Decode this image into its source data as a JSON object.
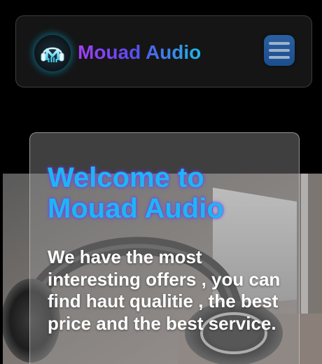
{
  "navbar": {
    "brand": "Mouad Audio",
    "logo_icon": "headphones-m-logo-icon",
    "menu_icon": "hamburger-menu-icon"
  },
  "hero": {
    "title": "Welcome to Mouad Audio",
    "text": "We have the most interesting offers , you can find haut qualitie , the best price and the best service.",
    "image_icon": "headphones-photo"
  },
  "colors": {
    "page_background": "#000000",
    "navbar_background": "#151515",
    "brand_gradient_start": "#a23ff7",
    "brand_gradient_end": "#1fb8e8",
    "menu_button": "#1b4e8e",
    "title_color": "#1eb6f2",
    "title_glow": "#6e3cff",
    "text_color": "#ffffff"
  }
}
